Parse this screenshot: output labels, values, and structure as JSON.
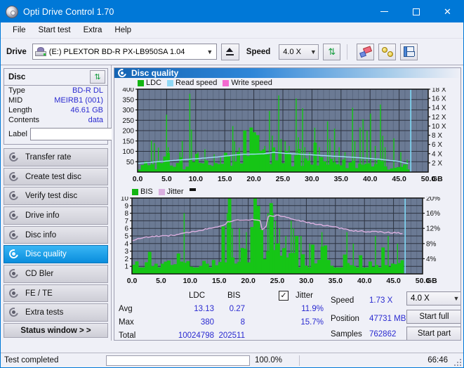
{
  "window": {
    "title": "Opti Drive Control 1.70",
    "icon": "disc-icon",
    "minimize": "minimize-icon",
    "maximize": "maximize-icon",
    "close": "close-icon"
  },
  "menu": {
    "items": [
      "File",
      "Start test",
      "Extra",
      "Help"
    ]
  },
  "toolbar": {
    "drive_label": "Drive",
    "drive_value": "(E:)  PLEXTOR BD-R  PX-LB950SA 1.04",
    "eject_icon": "eject-icon",
    "speed_label": "Speed",
    "speed_value": "4.0 X",
    "refresh_icon": "refresh-icon",
    "eraser_icon": "eraser-icon",
    "gold_icon": "coins-icon",
    "save_icon": "save-icon"
  },
  "sidebar": {
    "disc_panel": {
      "title": "Disc",
      "refresh_icon": "refresh-icon",
      "rows": [
        {
          "key": "Type",
          "value": "BD-R DL"
        },
        {
          "key": "MID",
          "value": "MEIRB1 (001)"
        },
        {
          "key": "Length",
          "value": "46.61 GB"
        },
        {
          "key": "Contents",
          "value": "data"
        }
      ],
      "label_key": "Label",
      "label_value": "",
      "label_placeholder": "",
      "cd_icon": "cd-icon"
    },
    "nav": [
      {
        "label": "Transfer rate",
        "active": false
      },
      {
        "label": "Create test disc",
        "active": false
      },
      {
        "label": "Verify test disc",
        "active": false
      },
      {
        "label": "Drive info",
        "active": false
      },
      {
        "label": "Disc info",
        "active": false
      },
      {
        "label": "Disc quality",
        "active": true
      },
      {
        "label": "CD Bler",
        "active": false
      },
      {
        "label": "FE / TE",
        "active": false
      },
      {
        "label": "Extra tests",
        "active": false
      }
    ],
    "status_window": "Status window > >"
  },
  "main": {
    "panel_title": "Disc quality",
    "panel_icon": "disc-quality-icon"
  },
  "stats": {
    "col_headers": [
      "LDC",
      "BIS"
    ],
    "rows": [
      {
        "label": "Avg",
        "ldc": "13.13",
        "bis": "0.27",
        "jitter": "11.9%"
      },
      {
        "label": "Max",
        "ldc": "380",
        "bis": "8",
        "jitter": "15.7%"
      },
      {
        "label": "Total",
        "ldc": "10024798",
        "bis": "202511",
        "jitter": ""
      }
    ],
    "jitter_label": "Jitter",
    "jitter_checked": true,
    "speed_label": "Speed",
    "speed_value": "1.73 X",
    "position_label": "Position",
    "position_value": "47731 MB",
    "samples_label": "Samples",
    "samples_value": "762862",
    "speed_select": "4.0 X",
    "start_full": "Start full",
    "start_part": "Start part"
  },
  "statusbar": {
    "text": "Test completed",
    "progress_percent": "100.0%",
    "progress_value": 100,
    "time": "66:46"
  },
  "chart_data": [
    {
      "id": "ldc-chart",
      "type": "bar",
      "title": "",
      "xlabel": "GB",
      "ylabel": "",
      "xlim": [
        0.0,
        50.0
      ],
      "ylim": [
        0,
        400
      ],
      "y2lim": [
        0,
        18
      ],
      "y2label": "X",
      "grid": true,
      "legend": [
        "LDC",
        "Read speed",
        "Write speed"
      ],
      "legend_colors": [
        "#12b512",
        "#8fd8f5",
        "#f56ad0"
      ],
      "plot_bg": "#6b7a94",
      "xticks": [
        "0.0",
        "5.0",
        "10.0",
        "15.0",
        "20.0",
        "25.0",
        "30.0",
        "35.0",
        "40.0",
        "45.0",
        "50.0"
      ],
      "yticks": [
        50,
        100,
        150,
        200,
        250,
        300,
        350,
        400
      ],
      "y2ticks": [
        "2 X",
        "4 X",
        "6 X",
        "8 X",
        "10 X",
        "12 X",
        "14 X",
        "16 X",
        "18 X"
      ],
      "series": [
        {
          "name": "LDC",
          "color": "#12b512",
          "note": "Dense green vertical error bars, baseline ~20-60 rising to a broad hump ~90-110 between 16-27 GB, scattered tall spikes.",
          "spikes_gb_value": [
            [
              2.3,
              152
            ],
            [
              2.8,
              140
            ],
            [
              3.5,
              118
            ],
            [
              4.9,
              277
            ],
            [
              5.2,
              120
            ],
            [
              7.2,
              96
            ],
            [
              7.6,
              150
            ],
            [
              8.9,
              378
            ],
            [
              9.2,
              205
            ],
            [
              10.3,
              96
            ],
            [
              11.5,
              110
            ],
            [
              13.1,
              86
            ],
            [
              14.2,
              76
            ],
            [
              16.3,
              222
            ],
            [
              16.6,
              148
            ],
            [
              17.4,
              118
            ],
            [
              18.6,
              104
            ],
            [
              19.5,
              96
            ],
            [
              20.3,
              92
            ],
            [
              21.8,
              126
            ],
            [
              22.6,
              295
            ],
            [
              23.1,
              176
            ],
            [
              23.5,
              120
            ],
            [
              24.2,
              370
            ],
            [
              24.6,
              160
            ],
            [
              25.3,
              148
            ],
            [
              26.0,
              126
            ],
            [
              27.2,
              355
            ],
            [
              27.6,
              168
            ],
            [
              28.3,
              308
            ],
            [
              28.7,
              120
            ],
            [
              29.5,
              96
            ],
            [
              30.4,
              214
            ],
            [
              31.2,
              120
            ],
            [
              32.6,
              245
            ],
            [
              33.0,
              160
            ],
            [
              33.8,
              210
            ],
            [
              34.6,
              120
            ],
            [
              35.6,
              96
            ],
            [
              36.9,
              310
            ],
            [
              37.3,
              150
            ],
            [
              38.2,
              215
            ],
            [
              38.7,
              255
            ],
            [
              39.4,
              200
            ],
            [
              40.0,
              282
            ],
            [
              40.8,
              126
            ],
            [
              41.7,
              326
            ],
            [
              42.1,
              175
            ],
            [
              42.5,
              120
            ],
            [
              44.0,
              163
            ],
            [
              45.2,
              96
            ],
            [
              46.3,
              60
            ]
          ]
        },
        {
          "name": "Read speed",
          "color": "#9fdcf7",
          "note": "Smooth CAV-like read speed curve",
          "points_gb_x": [
            [
              0.0,
              1.9
            ],
            [
              2.0,
              2.1
            ],
            [
              5.0,
              2.4
            ],
            [
              8.0,
              2.7
            ],
            [
              11.0,
              3.0
            ],
            [
              14.0,
              3.3
            ],
            [
              16.0,
              3.6
            ],
            [
              18.0,
              3.85
            ],
            [
              20.0,
              3.9
            ],
            [
              22.0,
              4.0
            ],
            [
              23.5,
              4.3
            ],
            [
              25.0,
              4.1
            ],
            [
              27.0,
              3.95
            ],
            [
              30.0,
              3.75
            ],
            [
              33.0,
              3.5
            ],
            [
              36.0,
              3.3
            ],
            [
              39.0,
              3.05
            ],
            [
              42.0,
              2.75
            ],
            [
              45.0,
              2.3
            ],
            [
              46.5,
              1.85
            ]
          ],
          "end_marker_gb": 47.0
        },
        {
          "name": "Write speed",
          "color": "#f56ad0",
          "note": "not plotted (no data)"
        }
      ]
    },
    {
      "id": "bis-jitter-chart",
      "type": "bar",
      "title": "",
      "xlabel": "GB",
      "xlim": [
        0.0,
        50.0
      ],
      "ylim": [
        0,
        10
      ],
      "y2lim": [
        0,
        20
      ],
      "y2label": "%",
      "grid": true,
      "legend": [
        "BIS",
        "Jitter"
      ],
      "legend_colors": [
        "#12b512",
        "#dbb0e0"
      ],
      "plot_bg": "#6b7a94",
      "xticks": [
        "0.0",
        "5.0",
        "10.0",
        "15.0",
        "20.0",
        "25.0",
        "30.0",
        "35.0",
        "40.0",
        "45.0",
        "50.0"
      ],
      "yticks": [
        1,
        2,
        3,
        4,
        5,
        6,
        7,
        8,
        9,
        10
      ],
      "y2ticks": [
        "4%",
        "8%",
        "12%",
        "16%",
        "20%"
      ],
      "series": [
        {
          "name": "BIS",
          "color": "#12b512",
          "note": "Dense green bars, baseline ~1-2 for 0-15 GB, rising to ~4-5 plateau 16-28 GB, back to ~2 afterward; isolated spikes to 8.",
          "spikes_gb_value": [
            [
              8.9,
              8
            ],
            [
              16.3,
              8
            ],
            [
              16.5,
              7
            ],
            [
              17.2,
              6
            ],
            [
              18.4,
              6
            ],
            [
              19.6,
              5.5
            ],
            [
              21.0,
              6
            ],
            [
              22.3,
              5.5
            ],
            [
              23.3,
              8
            ],
            [
              23.6,
              7.6
            ],
            [
              24.2,
              8
            ],
            [
              24.6,
              7
            ],
            [
              25.3,
              6
            ],
            [
              26.4,
              5
            ],
            [
              27.3,
              7
            ],
            [
              27.7,
              6
            ],
            [
              29.0,
              5
            ],
            [
              30.5,
              4
            ],
            [
              32.6,
              5.5
            ],
            [
              36.9,
              5.5
            ],
            [
              38.0,
              4
            ],
            [
              41.8,
              5
            ],
            [
              44.0,
              5
            ],
            [
              45.6,
              4
            ]
          ]
        },
        {
          "name": "Jitter",
          "color": "#dbb0e0",
          "note": "Smooth pink line, rises from ~8.8% to peak ~15.4% at 25 GB then declines to ~10.6%",
          "points_gb_pct": [
            [
              0.0,
              8.8
            ],
            [
              2.0,
              9.6
            ],
            [
              4.0,
              9.9
            ],
            [
              6.0,
              10.0
            ],
            [
              8.0,
              10.4
            ],
            [
              10.0,
              11.0
            ],
            [
              12.0,
              11.6
            ],
            [
              14.0,
              12.2
            ],
            [
              16.0,
              13.1
            ],
            [
              16.6,
              13.8
            ],
            [
              18.0,
              14.2
            ],
            [
              20.0,
              14.3
            ],
            [
              22.0,
              14.3
            ],
            [
              22.4,
              11.8
            ],
            [
              23.0,
              11.9
            ],
            [
              23.4,
              15.2
            ],
            [
              25.0,
              15.4
            ],
            [
              26.0,
              15.2
            ],
            [
              28.0,
              14.4
            ],
            [
              30.0,
              13.6
            ],
            [
              32.0,
              13.0
            ],
            [
              34.0,
              12.6
            ],
            [
              36.0,
              12.0
            ],
            [
              38.0,
              11.4
            ],
            [
              40.0,
              11.2
            ],
            [
              42.0,
              11.1
            ],
            [
              44.0,
              10.9
            ],
            [
              46.0,
              10.8
            ],
            [
              46.8,
              10.6
            ]
          ],
          "end_marker_gb": 47.0
        }
      ]
    }
  ]
}
